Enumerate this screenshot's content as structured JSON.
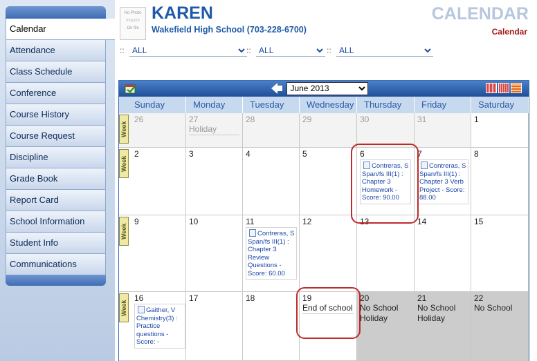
{
  "nav": {
    "items": [
      {
        "label": "Calendar",
        "active": true
      },
      {
        "label": "Attendance"
      },
      {
        "label": "Class Schedule"
      },
      {
        "label": "Conference"
      },
      {
        "label": "Course History"
      },
      {
        "label": "Course Request"
      },
      {
        "label": "Discipline"
      },
      {
        "label": "Grade Book"
      },
      {
        "label": "Report Card"
      },
      {
        "label": "School Information"
      },
      {
        "label": "Student Info"
      },
      {
        "label": "Communications"
      }
    ]
  },
  "header": {
    "photo_text": [
      "No Photo",
      "Impaire",
      "On file"
    ],
    "student_name": "KAREN",
    "school": "Wakefield High School (703-228-6700)",
    "page_title": "CALENDAR",
    "page_subtitle": "Calendar"
  },
  "filters": [
    {
      "prefix": "::",
      "value": "ALL"
    },
    {
      "prefix": "::",
      "value": "ALL"
    },
    {
      "prefix": "::",
      "value": "ALL"
    }
  ],
  "calendar": {
    "month": "June 2013",
    "week_label": "Week",
    "days_of_week": [
      "Sunday",
      "Monday",
      "Tuesday",
      "Wednesday",
      "Thursday",
      "Friday",
      "Saturday"
    ],
    "weeks": [
      [
        {
          "num": "26",
          "other": true
        },
        {
          "num": "27",
          "other": true,
          "note": "Holiday"
        },
        {
          "num": "28",
          "other": true
        },
        {
          "num": "29",
          "other": true
        },
        {
          "num": "30",
          "other": true
        },
        {
          "num": "31",
          "other": true
        },
        {
          "num": "1"
        }
      ],
      [
        {
          "num": "2"
        },
        {
          "num": "3"
        },
        {
          "num": "4"
        },
        {
          "num": "5"
        },
        {
          "num": "6",
          "asg": [
            "Contreras, S",
            "Span/fs III(1) :",
            "Chapter 3",
            "Homework -",
            "Score: 90.00"
          ]
        },
        {
          "num": "7",
          "asg": [
            "Contreras, S",
            "Span/fs III(1) :",
            "Chapter 3 Verb",
            "Project - Score:",
            "88.00"
          ]
        },
        {
          "num": "8"
        }
      ],
      [
        {
          "num": "9"
        },
        {
          "num": "10"
        },
        {
          "num": "11",
          "asg": [
            "Contreras, S",
            "Span/fs III(1) :",
            "Chapter 3",
            "Review",
            "Questions -",
            "Score: 60.00"
          ]
        },
        {
          "num": "12"
        },
        {
          "num": "13"
        },
        {
          "num": "14"
        },
        {
          "num": "15"
        }
      ],
      [
        {
          "num": "16",
          "asg": [
            "Gaither, V",
            "Chemistry(3) :",
            "Practice",
            "questions -",
            "Score: -"
          ]
        },
        {
          "num": "17"
        },
        {
          "num": "18"
        },
        {
          "num": "19",
          "note": "End of school"
        },
        {
          "num": "20",
          "gray": true,
          "note": "No School",
          "note2": "Holiday"
        },
        {
          "num": "21",
          "gray": true,
          "note": "No School",
          "note2": "Holiday"
        },
        {
          "num": "22",
          "gray": true,
          "note": "No School"
        }
      ]
    ]
  },
  "colors": {
    "accent": "#1f5aa8",
    "highlight": "#c12a2a",
    "nav_bg": "#c9d7ec"
  }
}
